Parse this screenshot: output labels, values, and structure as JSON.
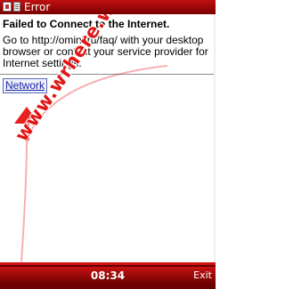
{
  "window": {
    "title": "Error"
  },
  "error": {
    "heading": "Failed to Connect to the Internet.",
    "message": "Go to http://omini.ru/faq/ with your desktop browser or contact your service provider for Internet settings."
  },
  "links": {
    "network": "Network"
  },
  "watermark": {
    "text": "www.wrhere.wap.sh",
    "color": "#e01616"
  },
  "status_bar": {
    "time": "08:34",
    "right_softkey": "Exit"
  },
  "colors": {
    "titlebar": "#a00000",
    "bottombar": "#6a0000",
    "link": "#1a22a8"
  },
  "icons": {
    "app": "opera-mini-app-icon",
    "page": "page-document-icon",
    "arrow": "up-arrow-watermark-icon"
  }
}
